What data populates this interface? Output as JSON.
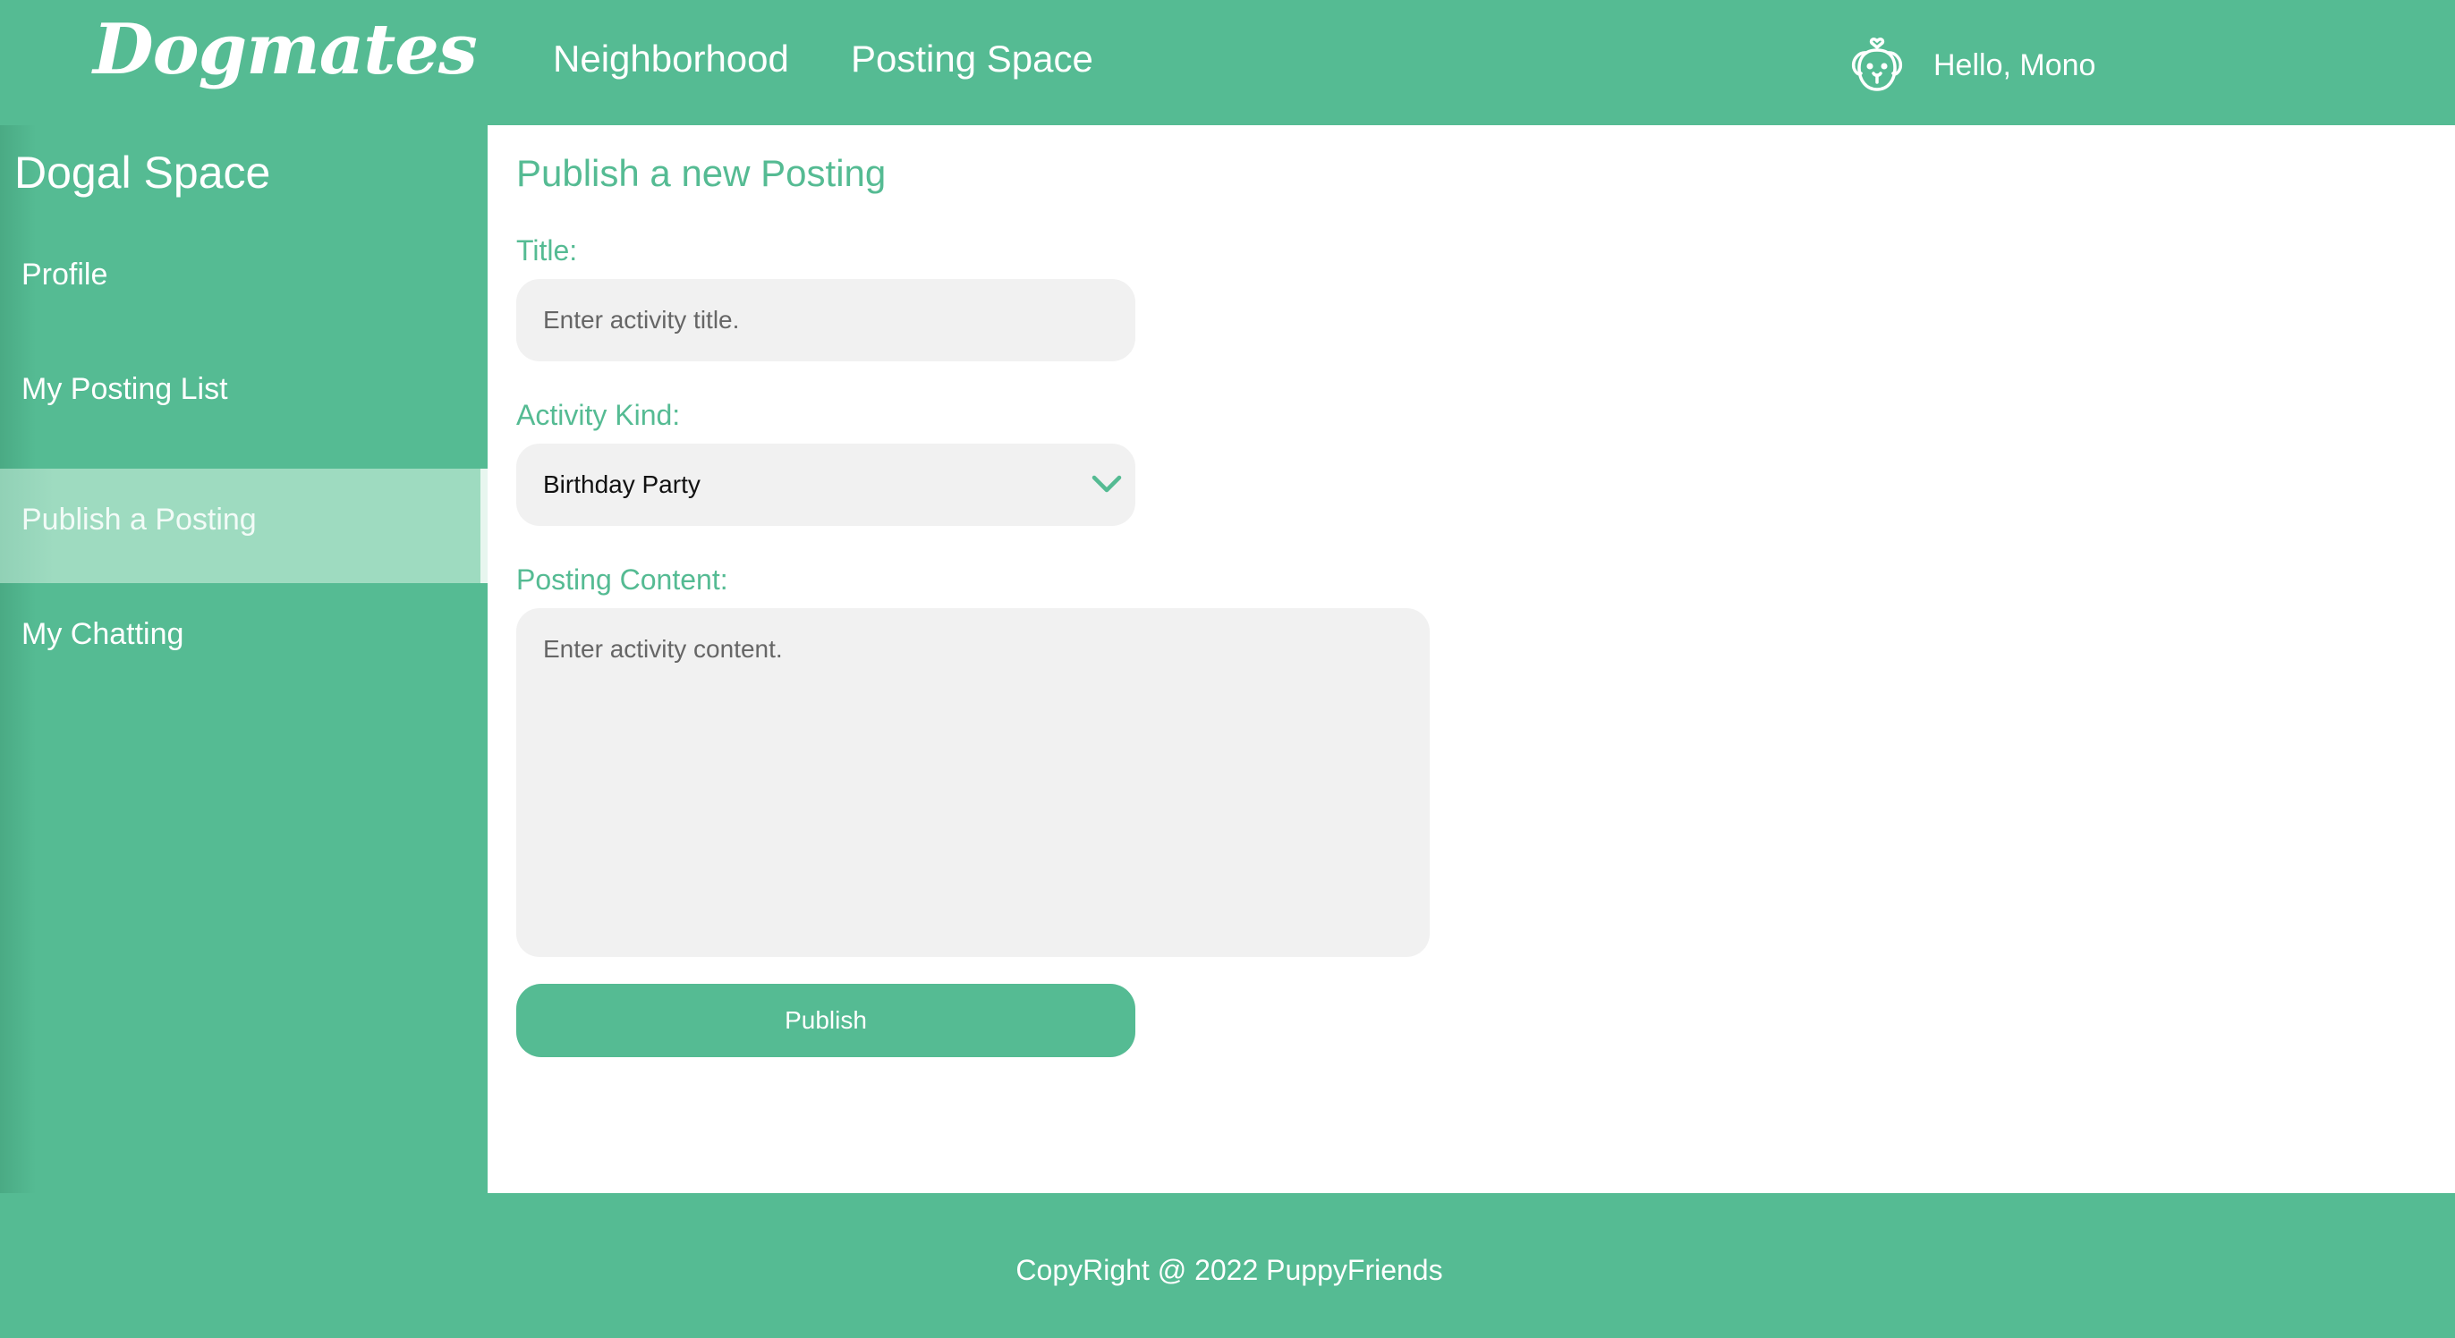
{
  "header": {
    "logo": "Dogmates",
    "nav": [
      "Neighborhood",
      "Posting Space"
    ],
    "greeting": "Hello, Mono",
    "user_icon": "dog-face-icon"
  },
  "sidebar": {
    "title": "Dogal Space",
    "items": [
      {
        "label": "Profile",
        "active": false
      },
      {
        "label": "My Posting List",
        "active": false
      },
      {
        "label": "Publish a Posting",
        "active": true
      },
      {
        "label": "My Chatting",
        "active": false
      }
    ]
  },
  "form": {
    "heading": "Publish a new Posting",
    "title_label": "Title:",
    "title_placeholder": "Enter activity title.",
    "kind_label": "Activity Kind:",
    "kind_selected": "Birthday Party",
    "content_label": "Posting Content:",
    "content_placeholder": "Enter activity content.",
    "publish_label": "Publish"
  },
  "footer": {
    "text": "CopyRight @ 2022 PuppyFriends"
  },
  "colors": {
    "brand": "#55bb93",
    "active_item": "#9edbc0",
    "field_bg": "#f1f1f1"
  }
}
